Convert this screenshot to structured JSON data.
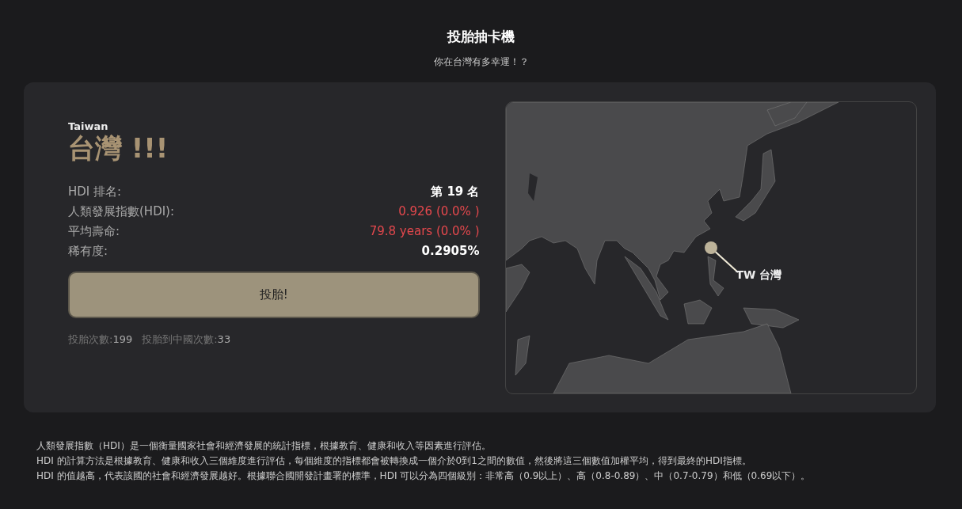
{
  "header": {
    "title": "投胎抽卡機",
    "subtitle": "你在台灣有多幸運！？"
  },
  "result": {
    "name_en": "Taiwan",
    "name": "台灣 !!!",
    "stats": [
      {
        "label": "HDI 排名:",
        "value": "第 19 名",
        "highlight": false
      },
      {
        "label": "人類發展指數(HDI):",
        "value": "0.926 (0.0% )",
        "highlight": true
      },
      {
        "label": "平均壽命:",
        "value": "79.8 years (0.0% )",
        "highlight": true
      },
      {
        "label": "稀有度:",
        "value": "0.2905%",
        "highlight": false
      }
    ],
    "button": "投胎!",
    "counts": [
      {
        "label": "投胎次數:",
        "value": "199"
      },
      {
        "label": "投胎到中國次數:",
        "value": "33"
      }
    ]
  },
  "map": {
    "pin_label": "TW 台灣"
  },
  "notes": [
    "人類發展指數（HDI）是一個衡量國家社會和經濟發展的統計指標，根據教育、健康和收入等因素進行評估。",
    "HDI 的計算方法是根據教育、健康和收入三個維度進行評估，每個維度的指標都會被轉換成一個介於0到1之間的數值，然後將這三個數值加權平均，得到最終的HDI指標。",
    "HDI 的值越高，代表該國的社會和經濟發展越好。根據聯合國開發計畫署的標準，HDI 可以分為四個級別：非常高（0.9以上）、高（0.8-0.89）、中（0.7-0.79）和低（0.69以下）。"
  ]
}
